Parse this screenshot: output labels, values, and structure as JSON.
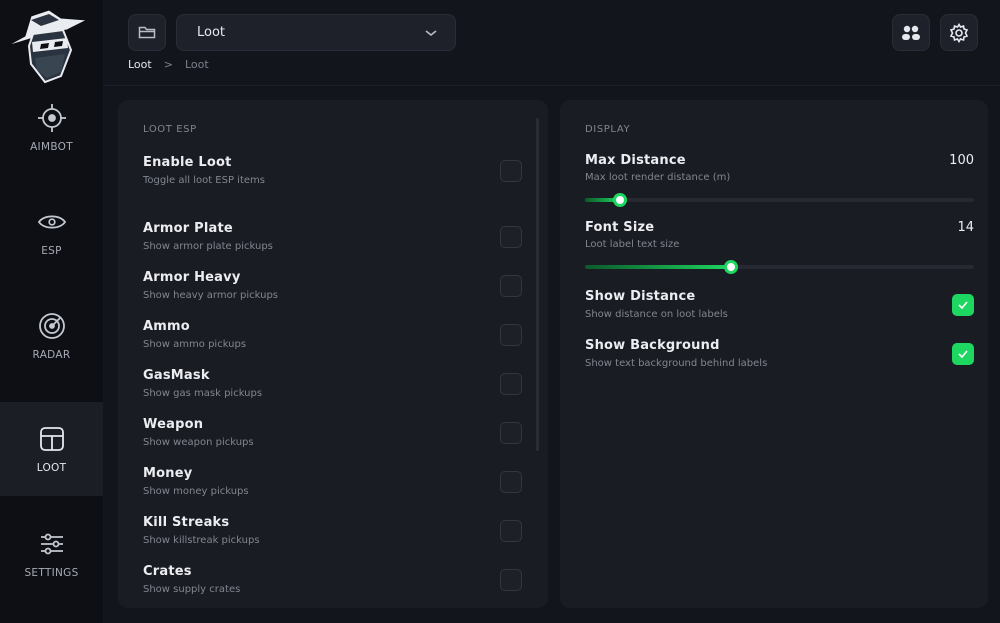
{
  "sidebar": {
    "items": [
      {
        "label": "AIMBOT",
        "icon": "crosshair-icon"
      },
      {
        "label": "ESP",
        "icon": "eye-icon"
      },
      {
        "label": "RADAR",
        "icon": "radar-icon"
      },
      {
        "label": "LOOT",
        "icon": "layout-icon",
        "active": true
      },
      {
        "label": "SETTINGS",
        "icon": "sliders-icon"
      }
    ]
  },
  "header": {
    "dropdown_value": "Loot",
    "breadcrumb": {
      "current": "Loot",
      "separator": ">",
      "previous": "Loot"
    }
  },
  "left_panel": {
    "section_title": "LOOT ESP",
    "rows": [
      {
        "title": "Enable Loot",
        "subtitle": "Toggle all loot ESP items",
        "checked": false
      },
      {
        "title": "Armor Plate",
        "subtitle": "Show armor plate pickups",
        "checked": false
      },
      {
        "title": "Armor Heavy",
        "subtitle": "Show heavy armor pickups",
        "checked": false
      },
      {
        "title": "Ammo",
        "subtitle": "Show ammo pickups",
        "checked": false
      },
      {
        "title": "GasMask",
        "subtitle": "Show gas mask pickups",
        "checked": false
      },
      {
        "title": "Weapon",
        "subtitle": "Show weapon pickups",
        "checked": false
      },
      {
        "title": "Money",
        "subtitle": "Show money pickups",
        "checked": false
      },
      {
        "title": "Kill Streaks",
        "subtitle": "Show killstreak pickups",
        "checked": false
      },
      {
        "title": "Crates",
        "subtitle": "Show supply crates",
        "checked": false
      }
    ]
  },
  "right_panel": {
    "section_title": "DISPLAY",
    "max_distance": {
      "title": "Max Distance",
      "subtitle": "Max loot render distance (m)",
      "value": "100",
      "fraction": 0.09
    },
    "font_size": {
      "title": "Font Size",
      "subtitle": "Loot label text size",
      "value": "14",
      "fraction": 0.375
    },
    "show_distance": {
      "title": "Show Distance",
      "subtitle": "Show distance on loot labels",
      "checked": true
    },
    "show_background": {
      "title": "Show Background",
      "subtitle": "Show text background behind labels",
      "checked": true
    }
  },
  "colors": {
    "accent": "#1ed760",
    "background": "#13151c",
    "panel": "#1a1c24",
    "sidebar": "#0d0f15"
  }
}
